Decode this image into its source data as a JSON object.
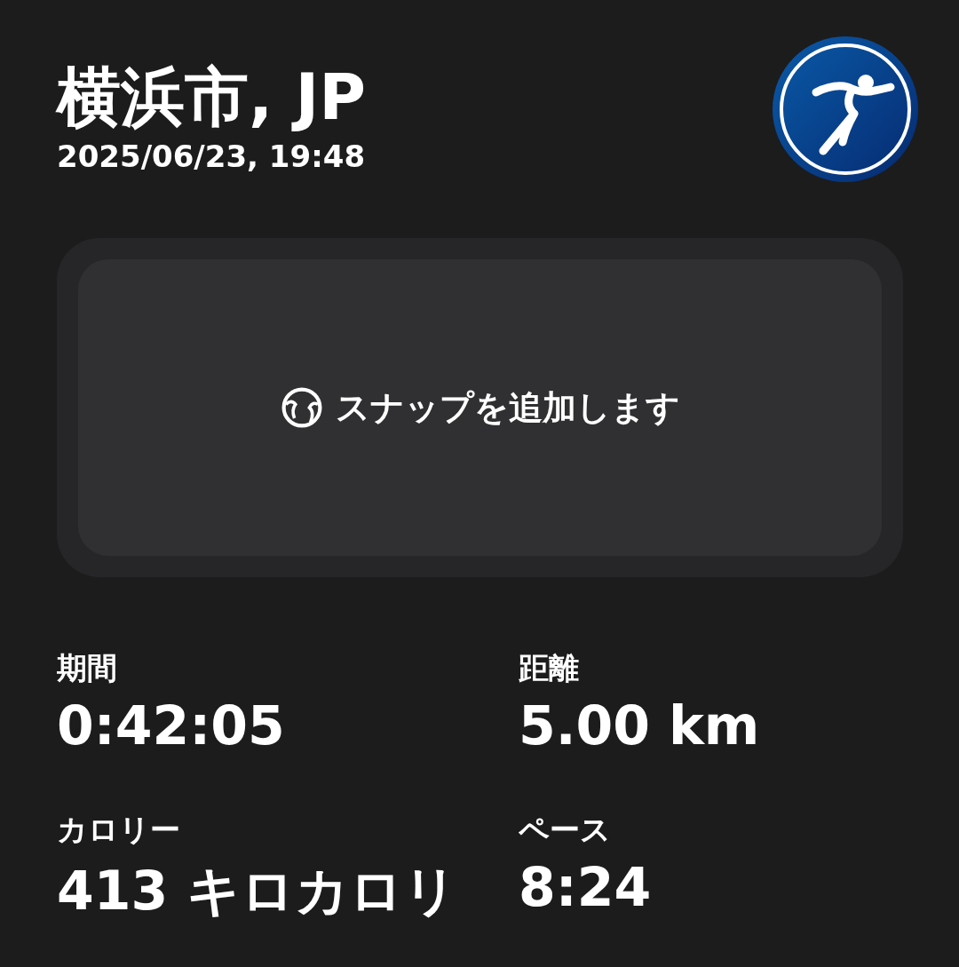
{
  "header": {
    "title": "横浜市, JP",
    "datetime": "2025/06/23, 19:48"
  },
  "snap": {
    "label": "スナップを追加します"
  },
  "stats": [
    {
      "label": "期間",
      "value": "0:42:05"
    },
    {
      "label": "距離",
      "value": "5.00 km"
    },
    {
      "label": "カロリー",
      "value": "413 キロカロリ"
    },
    {
      "label": "ペース",
      "value": "8:24"
    }
  ]
}
